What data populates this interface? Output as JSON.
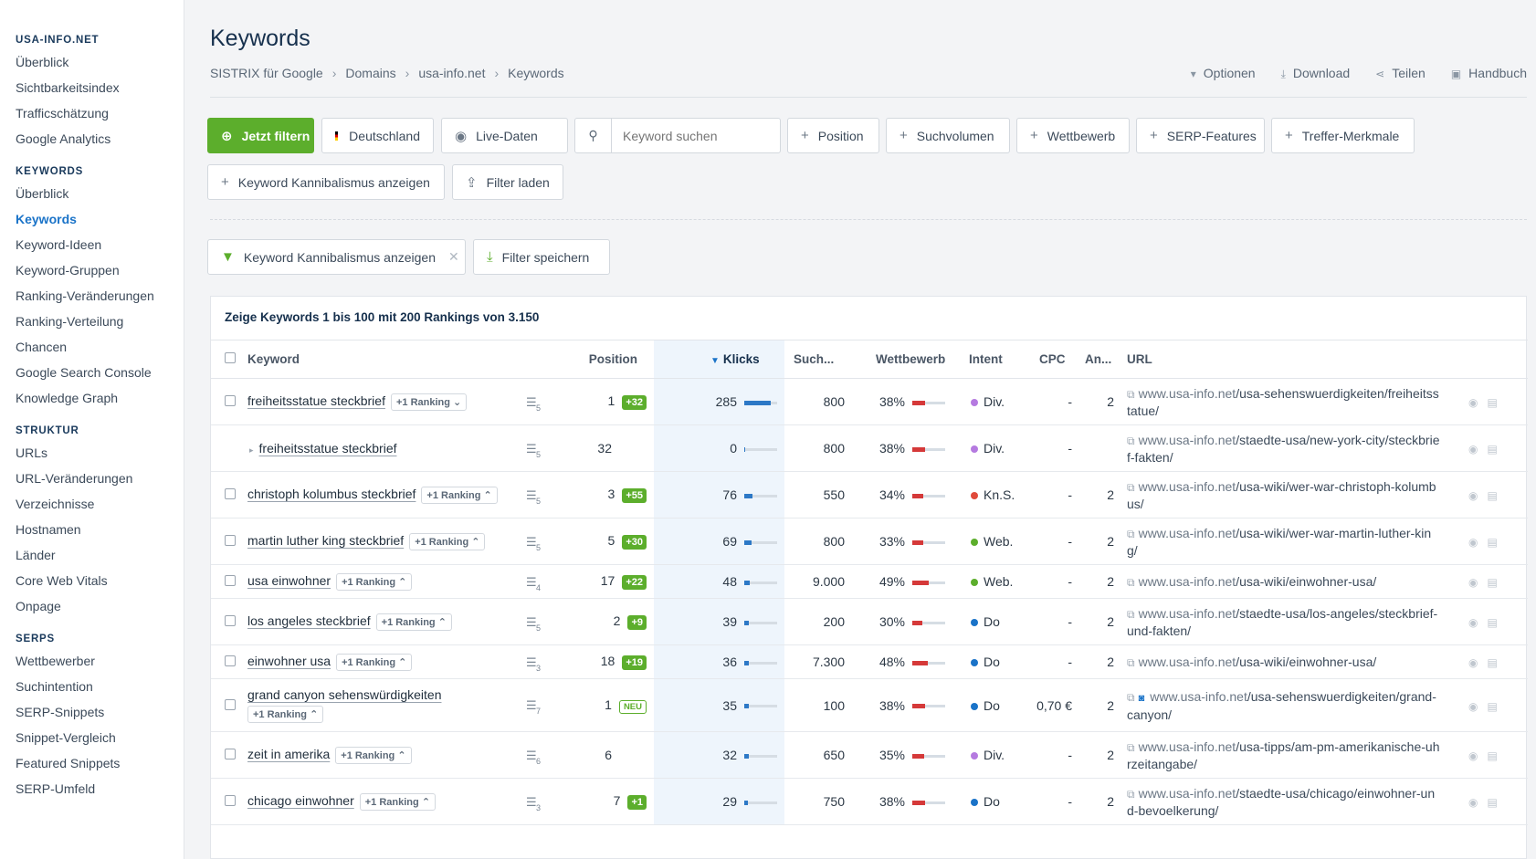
{
  "sidebar": {
    "sections": [
      {
        "title": "USA-INFO.NET",
        "items": [
          "Überblick",
          "Sichtbarkeitsindex",
          "Trafficschätzung",
          "Google Analytics"
        ]
      },
      {
        "title": "KEYWORDS",
        "items": [
          "Überblick",
          "Keywords",
          "Keyword-Ideen",
          "Keyword-Gruppen",
          "Ranking-Veränderungen",
          "Ranking-Verteilung",
          "Chancen",
          "Google Search Console",
          "Knowledge Graph"
        ]
      },
      {
        "title": "STRUKTUR",
        "items": [
          "URLs",
          "URL-Veränderungen",
          "Verzeichnisse",
          "Hostnamen",
          "Länder",
          "Core Web Vitals",
          "Onpage"
        ]
      },
      {
        "title": "SERPS",
        "items": [
          "Wettbewerber",
          "Suchintention",
          "SERP-Snippets",
          "Snippet-Vergleich",
          "Featured Snippets",
          "SERP-Umfeld"
        ]
      }
    ],
    "active": "Keywords"
  },
  "page": {
    "title": "Keywords",
    "breadcrumb": [
      "SISTRIX für Google",
      "Domains",
      "usa-info.net",
      "Keywords"
    ],
    "actions": [
      "Optionen",
      "Download",
      "Teilen",
      "Handbuch"
    ]
  },
  "filters": {
    "jetzt": "Jetzt filtern",
    "country": "Deutschland",
    "live": "Live-Daten",
    "search_placeholder": "Keyword suchen",
    "position": "Position",
    "suchvolumen": "Suchvolumen",
    "wettbewerb": "Wettbewerb",
    "serp_features": "SERP-Features",
    "treffer": "Treffer-Merkmale",
    "kannibalismus": "Keyword Kannibalismus anzeigen",
    "filter_laden": "Filter laden",
    "active_filter": "Keyword Kannibalismus anzeigen",
    "filter_speichern": "Filter speichern"
  },
  "table": {
    "summary": "Zeige Keywords 1 bis 100 mit 200 Rankings von 3.150",
    "headers": {
      "keyword": "Keyword",
      "position": "Position",
      "klicks": "Klicks",
      "such": "Such...",
      "wettbewerb": "Wettbewerb",
      "intent": "Intent",
      "cpc": "CPC",
      "an": "An...",
      "url": "URL"
    },
    "rows": [
      {
        "keyword": "freiheitsstatue steckbrief",
        "badge": "+1 Ranking",
        "badge_arrow": "down",
        "serp": "5",
        "position": "1",
        "change": "+32",
        "klicks": "285",
        "klicks_pct": 0.8,
        "such": "800",
        "wett": "38%",
        "wett_pct": 0.38,
        "intent": "Div.",
        "intent_color": "#b57ae0",
        "cpc": "-",
        "an": "2",
        "url_domain": "www.usa-info.net",
        "url_path": "/usa-sehenswuerdigkeiten/freiheitsstatue/",
        "h": 51
      },
      {
        "sub": true,
        "keyword": "freiheitsstatue steckbrief",
        "serp": "5",
        "position": "32",
        "klicks": "0",
        "klicks_pct": 0.02,
        "such": "800",
        "wett": "38%",
        "wett_pct": 0.38,
        "intent": "Div.",
        "intent_color": "#b57ae0",
        "cpc": "-",
        "an": "",
        "url_domain": "www.usa-info.net",
        "url_path": "/staedte-usa/new-york-city/steckbrief-fakten/",
        "h": 51
      },
      {
        "keyword": "christoph kolumbus steckbrief",
        "badge": "+1 Ranking",
        "badge_arrow": "up",
        "serp": "5",
        "position": "3",
        "change": "+55",
        "klicks": "76",
        "klicks_pct": 0.25,
        "such": "550",
        "wett": "34%",
        "wett_pct": 0.34,
        "intent": "Kn.S.",
        "intent_color": "#e04a3b",
        "cpc": "-",
        "an": "2",
        "url_domain": "www.usa-info.net",
        "url_path": "/usa-wiki/wer-war-christoph-kolumbus/",
        "h": 51
      },
      {
        "keyword": "martin luther king steckbrief",
        "badge": "+1 Ranking",
        "badge_arrow": "up",
        "serp": "5",
        "position": "5",
        "change": "+30",
        "klicks": "69",
        "klicks_pct": 0.23,
        "such": "800",
        "wett": "33%",
        "wett_pct": 0.33,
        "intent": "Web.",
        "intent_color": "#5cae2c",
        "cpc": "-",
        "an": "2",
        "url_domain": "www.usa-info.net",
        "url_path": "/usa-wiki/wer-war-martin-luther-king/",
        "h": 51
      },
      {
        "keyword": "usa einwohner",
        "badge": "+1 Ranking",
        "badge_arrow": "up",
        "serp": "4",
        "position": "17",
        "change": "+22",
        "klicks": "48",
        "klicks_pct": 0.18,
        "such": "9.000",
        "wett": "49%",
        "wett_pct": 0.49,
        "intent": "Web.",
        "intent_color": "#5cae2c",
        "cpc": "-",
        "an": "2",
        "url_domain": "www.usa-info.net",
        "url_path": "/usa-wiki/einwohner-usa/",
        "h": 37
      },
      {
        "keyword": "los angeles steckbrief",
        "badge": "+1 Ranking",
        "badge_arrow": "up",
        "serp": "5",
        "position": "2",
        "change": "+9",
        "klicks": "39",
        "klicks_pct": 0.15,
        "such": "200",
        "wett": "30%",
        "wett_pct": 0.3,
        "intent": "Do",
        "intent_color": "#1a73c8",
        "cpc": "-",
        "an": "2",
        "url_domain": "www.usa-info.net",
        "url_path": "/staedte-usa/los-angeles/steckbrief-und-fakten/",
        "h": 51
      },
      {
        "keyword": "einwohner usa",
        "badge": "+1 Ranking",
        "badge_arrow": "up",
        "serp": "3",
        "position": "18",
        "change": "+19",
        "klicks": "36",
        "klicks_pct": 0.14,
        "such": "7.300",
        "wett": "48%",
        "wett_pct": 0.48,
        "intent": "Do",
        "intent_color": "#1a73c8",
        "cpc": "-",
        "an": "2",
        "url_domain": "www.usa-info.net",
        "url_path": "/usa-wiki/einwohner-usa/",
        "h": 37
      },
      {
        "keyword": "grand canyon sehenswürdigkeiten",
        "badge": "+1 Ranking",
        "badge_arrow": "up",
        "badge_below": true,
        "serp": "7",
        "position": "1",
        "neu": "NEU",
        "klicks": "35",
        "klicks_pct": 0.14,
        "such": "100",
        "wett": "38%",
        "wett_pct": 0.38,
        "intent": "Do",
        "intent_color": "#1a73c8",
        "cpc": "0,70 €",
        "an": "2",
        "camera": true,
        "url_domain": "www.usa-info.net",
        "url_path": "/usa-sehenswuerdigkeiten/grand-canyon/",
        "h": 58
      },
      {
        "keyword": "zeit in amerika",
        "badge": "+1 Ranking",
        "badge_arrow": "up",
        "serp": "6",
        "position": "6",
        "klicks": "32",
        "klicks_pct": 0.13,
        "such": "650",
        "wett": "35%",
        "wett_pct": 0.35,
        "intent": "Div.",
        "intent_color": "#b57ae0",
        "cpc": "-",
        "an": "2",
        "url_domain": "www.usa-info.net",
        "url_path": "/usa-tipps/am-pm-amerikanische-uhrzeitangabe/",
        "h": 51
      },
      {
        "keyword": "chicago einwohner",
        "badge": "+1 Ranking",
        "badge_arrow": "up",
        "serp": "3",
        "position": "7",
        "change": "+1",
        "klicks": "29",
        "klicks_pct": 0.12,
        "such": "750",
        "wett": "38%",
        "wett_pct": 0.38,
        "intent": "Do",
        "intent_color": "#1a73c8",
        "cpc": "-",
        "an": "2",
        "url_domain": "www.usa-info.net",
        "url_path": "/staedte-usa/chicago/einwohner-und-bevoelkerung/",
        "h": 51
      }
    ]
  },
  "colors": {
    "accent_green": "#5cae2c",
    "link_blue": "#1a73c8",
    "title_navy": "#16304d"
  }
}
